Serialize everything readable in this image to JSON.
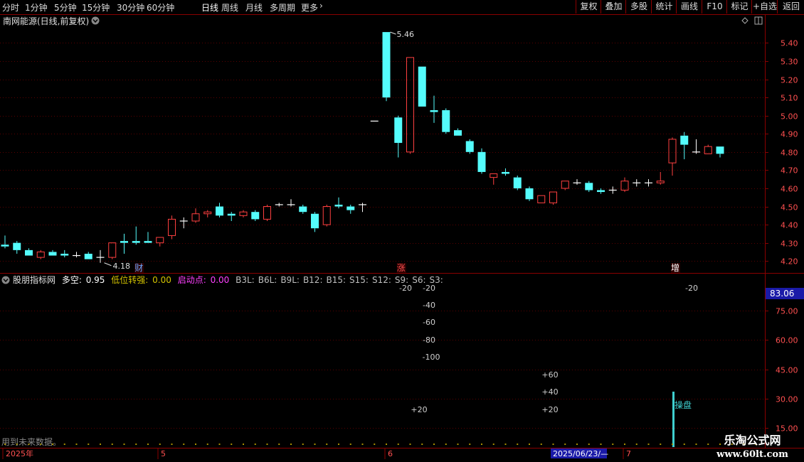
{
  "toolbar": {
    "timeframes": [
      "分时",
      "1分钟",
      "5分钟",
      "15分钟",
      "30分钟",
      "60分钟",
      "日线",
      "周线",
      "月线",
      "多周期",
      "更多"
    ],
    "active_timeframe": "日线",
    "buttons": [
      "复权",
      "叠加",
      "多股",
      "统计",
      "画线",
      "F10",
      "标记",
      "+自选",
      "返回"
    ]
  },
  "main_panel": {
    "title": "南网能源(日线,前复权)",
    "y_ticks": [
      5.4,
      5.3,
      5.2,
      5.1,
      5.0,
      4.9,
      4.8,
      4.7,
      4.6,
      4.5,
      4.4,
      4.3,
      4.2
    ],
    "y_range": [
      4.15,
      5.48
    ],
    "high_label": "5.46",
    "low_label": "4.18",
    "markers": [
      {
        "text": "财",
        "index": 11
      },
      {
        "text": "涨",
        "index": 33
      },
      {
        "text": "增",
        "index": 56
      }
    ]
  },
  "chart_data": {
    "type": "candlestick",
    "candles": [
      {
        "o": 4.29,
        "h": 4.34,
        "l": 4.27,
        "c": 4.28
      },
      {
        "o": 4.3,
        "h": 4.31,
        "l": 4.24,
        "c": 4.26
      },
      {
        "o": 4.26,
        "h": 4.27,
        "l": 4.23,
        "c": 4.23
      },
      {
        "o": 4.22,
        "h": 4.26,
        "l": 4.21,
        "c": 4.25
      },
      {
        "o": 4.25,
        "h": 4.26,
        "l": 4.23,
        "c": 4.23
      },
      {
        "o": 4.24,
        "h": 4.26,
        "l": 4.22,
        "c": 4.23
      },
      {
        "o": 4.23,
        "h": 4.25,
        "l": 4.22,
        "c": 4.23
      },
      {
        "o": 4.24,
        "h": 4.25,
        "l": 4.21,
        "c": 4.21
      },
      {
        "o": 4.22,
        "h": 4.26,
        "l": 4.19,
        "c": 4.22
      },
      {
        "o": 4.22,
        "h": 4.3,
        "l": 4.21,
        "c": 4.3
      },
      {
        "o": 4.31,
        "h": 4.35,
        "l": 4.24,
        "c": 4.3
      },
      {
        "o": 4.31,
        "h": 4.39,
        "l": 4.29,
        "c": 4.3
      },
      {
        "o": 4.31,
        "h": 4.36,
        "l": 4.3,
        "c": 4.3
      },
      {
        "o": 4.3,
        "h": 4.33,
        "l": 4.28,
        "c": 4.33
      },
      {
        "o": 4.34,
        "h": 4.45,
        "l": 4.32,
        "c": 4.43
      },
      {
        "o": 4.42,
        "h": 4.44,
        "l": 4.38,
        "c": 4.42
      },
      {
        "o": 4.42,
        "h": 4.49,
        "l": 4.41,
        "c": 4.46
      },
      {
        "o": 4.46,
        "h": 4.48,
        "l": 4.44,
        "c": 4.47
      },
      {
        "o": 4.5,
        "h": 4.52,
        "l": 4.44,
        "c": 4.45
      },
      {
        "o": 4.46,
        "h": 4.47,
        "l": 4.42,
        "c": 4.45
      },
      {
        "o": 4.45,
        "h": 4.48,
        "l": 4.44,
        "c": 4.47
      },
      {
        "o": 4.47,
        "h": 4.48,
        "l": 4.42,
        "c": 4.43
      },
      {
        "o": 4.43,
        "h": 4.51,
        "l": 4.42,
        "c": 4.5
      },
      {
        "o": 4.51,
        "h": 4.52,
        "l": 4.5,
        "c": 4.51
      },
      {
        "o": 4.51,
        "h": 4.54,
        "l": 4.5,
        "c": 4.51
      },
      {
        "o": 4.5,
        "h": 4.51,
        "l": 4.46,
        "c": 4.47
      },
      {
        "o": 4.46,
        "h": 4.47,
        "l": 4.36,
        "c": 4.38
      },
      {
        "o": 4.4,
        "h": 4.51,
        "l": 4.39,
        "c": 4.5
      },
      {
        "o": 4.51,
        "h": 4.55,
        "l": 4.49,
        "c": 4.5
      },
      {
        "o": 4.5,
        "h": 4.51,
        "l": 4.46,
        "c": 4.48
      },
      {
        "o": 4.51,
        "h": 4.52,
        "l": 4.47,
        "c": 4.51
      },
      {
        "o": 4.97,
        "h": 4.97,
        "l": 4.97,
        "c": 4.97
      },
      {
        "o": 5.46,
        "h": 5.46,
        "l": 5.08,
        "c": 5.1
      },
      {
        "o": 4.99,
        "h": 5.0,
        "l": 4.77,
        "c": 4.85
      },
      {
        "o": 4.8,
        "h": 5.32,
        "l": 4.79,
        "c": 5.32
      },
      {
        "o": 5.27,
        "h": 5.27,
        "l": 5.05,
        "c": 5.05
      },
      {
        "o": 5.03,
        "h": 5.11,
        "l": 4.96,
        "c": 5.02
      },
      {
        "o": 5.03,
        "h": 5.04,
        "l": 4.9,
        "c": 4.91
      },
      {
        "o": 4.92,
        "h": 4.93,
        "l": 4.89,
        "c": 4.89
      },
      {
        "o": 4.86,
        "h": 4.87,
        "l": 4.79,
        "c": 4.8
      },
      {
        "o": 4.8,
        "h": 4.82,
        "l": 4.68,
        "c": 4.69
      },
      {
        "o": 4.66,
        "h": 4.68,
        "l": 4.62,
        "c": 4.68
      },
      {
        "o": 4.69,
        "h": 4.71,
        "l": 4.67,
        "c": 4.68
      },
      {
        "o": 4.66,
        "h": 4.67,
        "l": 4.59,
        "c": 4.6
      },
      {
        "o": 4.6,
        "h": 4.61,
        "l": 4.53,
        "c": 4.54
      },
      {
        "o": 4.52,
        "h": 4.56,
        "l": 4.52,
        "c": 4.56
      },
      {
        "o": 4.52,
        "h": 4.58,
        "l": 4.51,
        "c": 4.58
      },
      {
        "o": 4.6,
        "h": 4.64,
        "l": 4.59,
        "c": 4.64
      },
      {
        "o": 4.63,
        "h": 4.65,
        "l": 4.62,
        "c": 4.63
      },
      {
        "o": 4.63,
        "h": 4.64,
        "l": 4.58,
        "c": 4.59
      },
      {
        "o": 4.59,
        "h": 4.6,
        "l": 4.57,
        "c": 4.58
      },
      {
        "o": 4.59,
        "h": 4.61,
        "l": 4.57,
        "c": 4.59
      },
      {
        "o": 4.59,
        "h": 4.66,
        "l": 4.58,
        "c": 4.64
      },
      {
        "o": 4.63,
        "h": 4.65,
        "l": 4.61,
        "c": 4.63
      },
      {
        "o": 4.63,
        "h": 4.65,
        "l": 4.61,
        "c": 4.63
      },
      {
        "o": 4.63,
        "h": 4.69,
        "l": 4.62,
        "c": 4.64
      },
      {
        "o": 4.74,
        "h": 4.88,
        "l": 4.67,
        "c": 4.87
      },
      {
        "o": 4.89,
        "h": 4.91,
        "l": 4.76,
        "c": 4.84
      },
      {
        "o": 4.8,
        "h": 4.87,
        "l": 4.79,
        "c": 4.8
      },
      {
        "o": 4.79,
        "h": 4.84,
        "l": 4.79,
        "c": 4.83
      },
      {
        "o": 4.83,
        "h": 4.83,
        "l": 4.77,
        "c": 4.79
      }
    ],
    "up_color": "#ff4040",
    "down_color": "#54fcfc",
    "grid": true
  },
  "indicator_panel": {
    "name": "股朋指标网",
    "duo_kong_label": "多空:",
    "duo_kong_value": "0.95",
    "low_turn_label": "低位转强:",
    "low_turn_value": "0.00",
    "start_label": "启动点:",
    "start_value": "0.00",
    "tags": [
      "B3L:",
      "B6L:",
      "B9L:",
      "B12:",
      "B15:",
      "S15:",
      "S12:",
      "S9:",
      "S6:",
      "S3:"
    ],
    "y_ticks": [
      "75.00",
      "60.00",
      "45.00",
      "30.00",
      "15.00"
    ],
    "current_value": "83.06",
    "overlay_labels": [
      {
        "text": "-20",
        "x": 570,
        "y": 409
      },
      {
        "text": "-20",
        "x": 603,
        "y": 409
      },
      {
        "text": "-40",
        "x": 603,
        "y": 433
      },
      {
        "text": "-60",
        "x": 603,
        "y": 457
      },
      {
        "text": "-80",
        "x": 603,
        "y": 482
      },
      {
        "text": "-100",
        "x": 606,
        "y": 506
      },
      {
        "text": "+60",
        "x": 773,
        "y": 531
      },
      {
        "text": "+40",
        "x": 773,
        "y": 555
      },
      {
        "text": "+20",
        "x": 589,
        "y": 580
      },
      {
        "text": "+20",
        "x": 773,
        "y": 580
      },
      {
        "text": "-20",
        "x": 972,
        "y": 409
      }
    ],
    "bar_label": "操盘",
    "future_note": "用到未来数据。"
  },
  "timeline": {
    "labels": [
      "2025年",
      "5",
      "6",
      "7"
    ],
    "cursor_date": "2025/06/23/—"
  },
  "watermark": {
    "name": "乐淘公式网",
    "url": "www.60lt.com"
  },
  "colors": {
    "frame": "#8b0000",
    "up": "#ff4040",
    "down": "#54fcfc",
    "axis_text": "#ff5050",
    "duo_kong": "#ffffff",
    "low_turn": "#d4c400",
    "start_point": "#ff40ff",
    "tags": "#bfbfbf"
  },
  "icons": [
    "collapse-down-icon",
    "chevron-right-icon",
    "diamond-icon",
    "panel-toggle-icon"
  ]
}
